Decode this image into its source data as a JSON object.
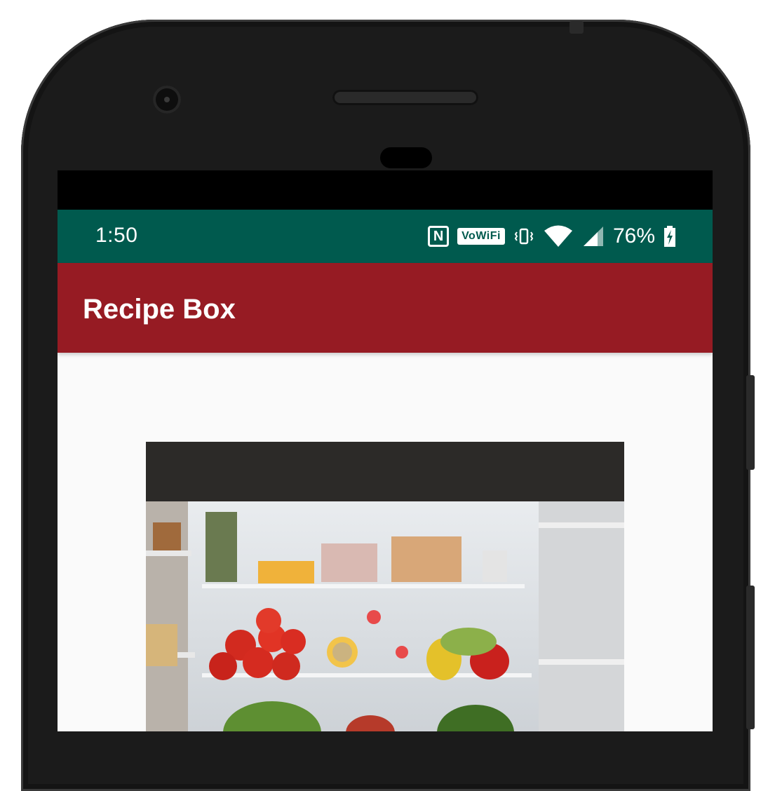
{
  "status_bar": {
    "time": "1:50",
    "nfc_icon": "N",
    "vowifi_badge": "VoWiFi",
    "battery_percent": "76%",
    "icons": [
      "nfc-icon",
      "vowifi-icon",
      "vibrate-icon",
      "wifi-icon",
      "signal-icon",
      "battery-charging-icon"
    ]
  },
  "app_bar": {
    "title": "Recipe Box",
    "color": "#961b23"
  },
  "content": {
    "image_name": "fridge-photo"
  },
  "colors": {
    "status_bar": "#005a4e",
    "app_bar": "#961b23",
    "background": "#fafafa",
    "card": "#2c2a28"
  }
}
